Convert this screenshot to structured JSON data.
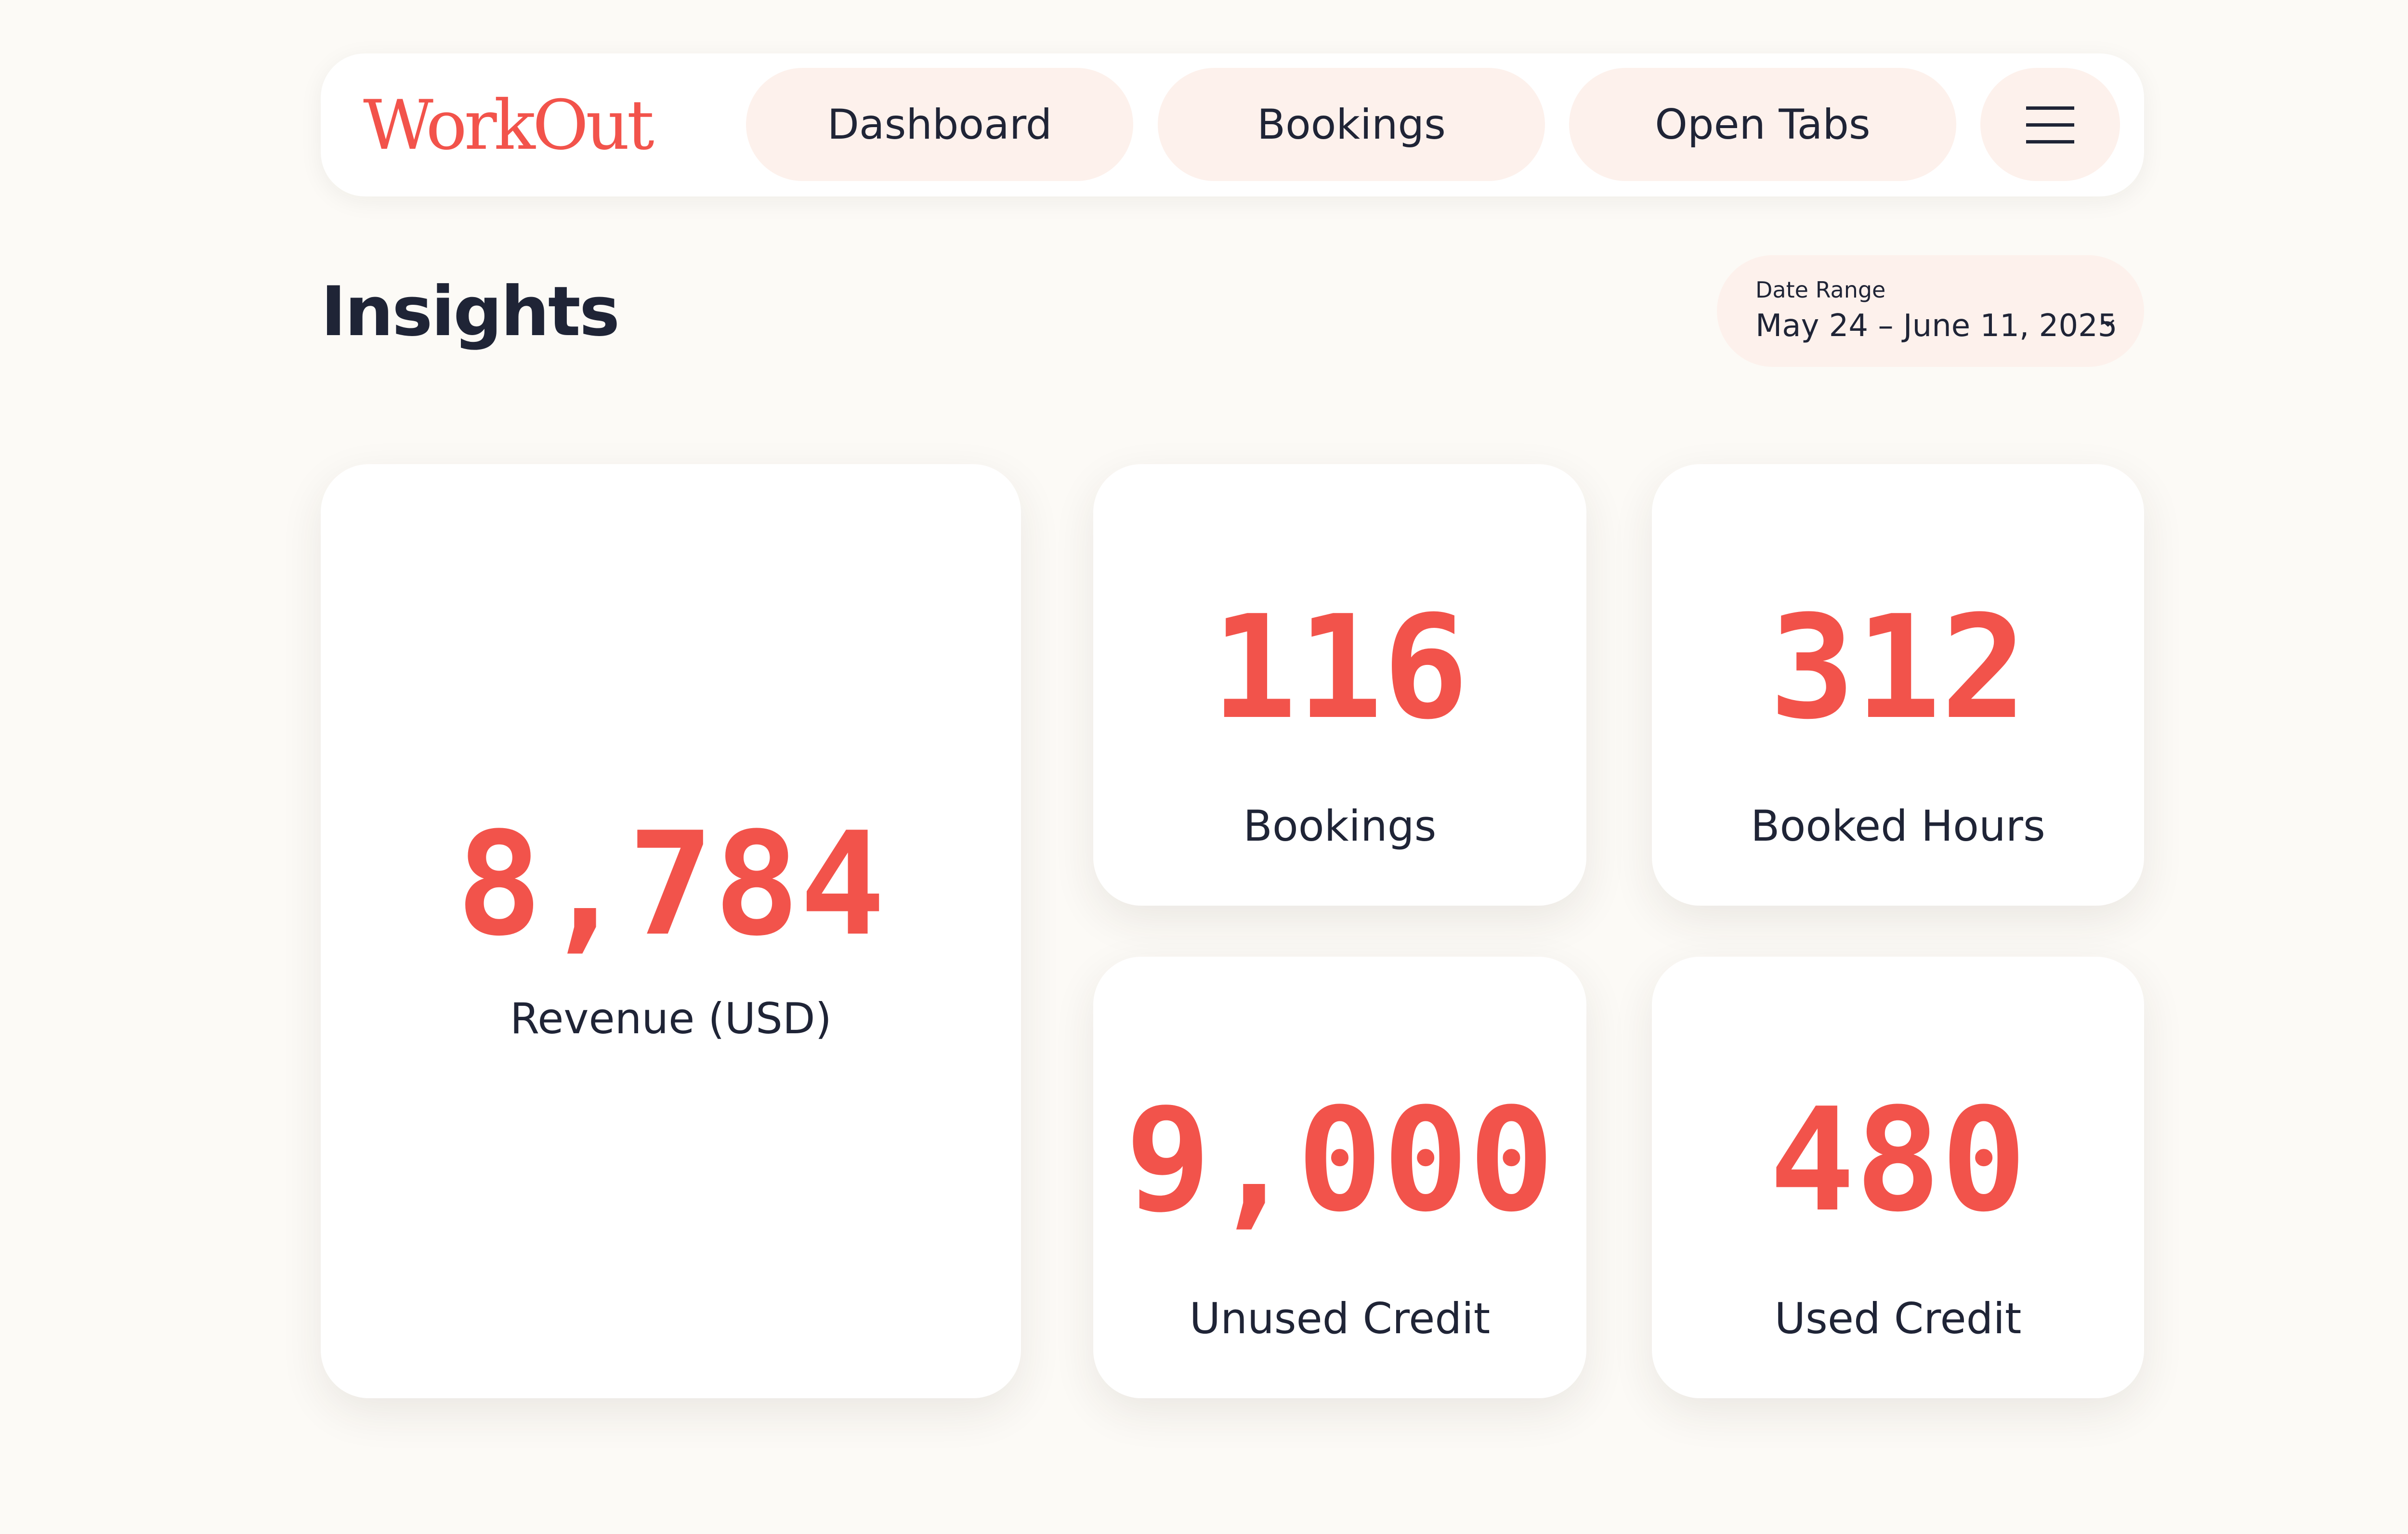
{
  "header": {
    "logo": "WorkOut",
    "nav": {
      "dashboard": "Dashboard",
      "bookings": "Bookings",
      "open_tabs": "Open Tabs"
    },
    "menu_icon": "hamburger-menu-icon"
  },
  "page": {
    "title": "Insights"
  },
  "date_range": {
    "label": "Date Range",
    "value": "May 24 – June 11, 2025",
    "icon": "chevron-down-icon"
  },
  "stats": {
    "revenue": {
      "value": "8,784",
      "label": "Revenue (USD)"
    },
    "bookings": {
      "value": "116",
      "label": "Bookings"
    },
    "booked_hours": {
      "value": "312",
      "label": "Booked Hours"
    },
    "unused_credit": {
      "value": "9,000",
      "label": "Unused Credit"
    },
    "used_credit": {
      "value": "480",
      "label": "Used Credit"
    }
  },
  "colors": {
    "accent": "#f2534b",
    "text": "#1f2436",
    "background": "#fcfaf6",
    "pill": "#fdf1ec",
    "card": "#ffffff"
  }
}
